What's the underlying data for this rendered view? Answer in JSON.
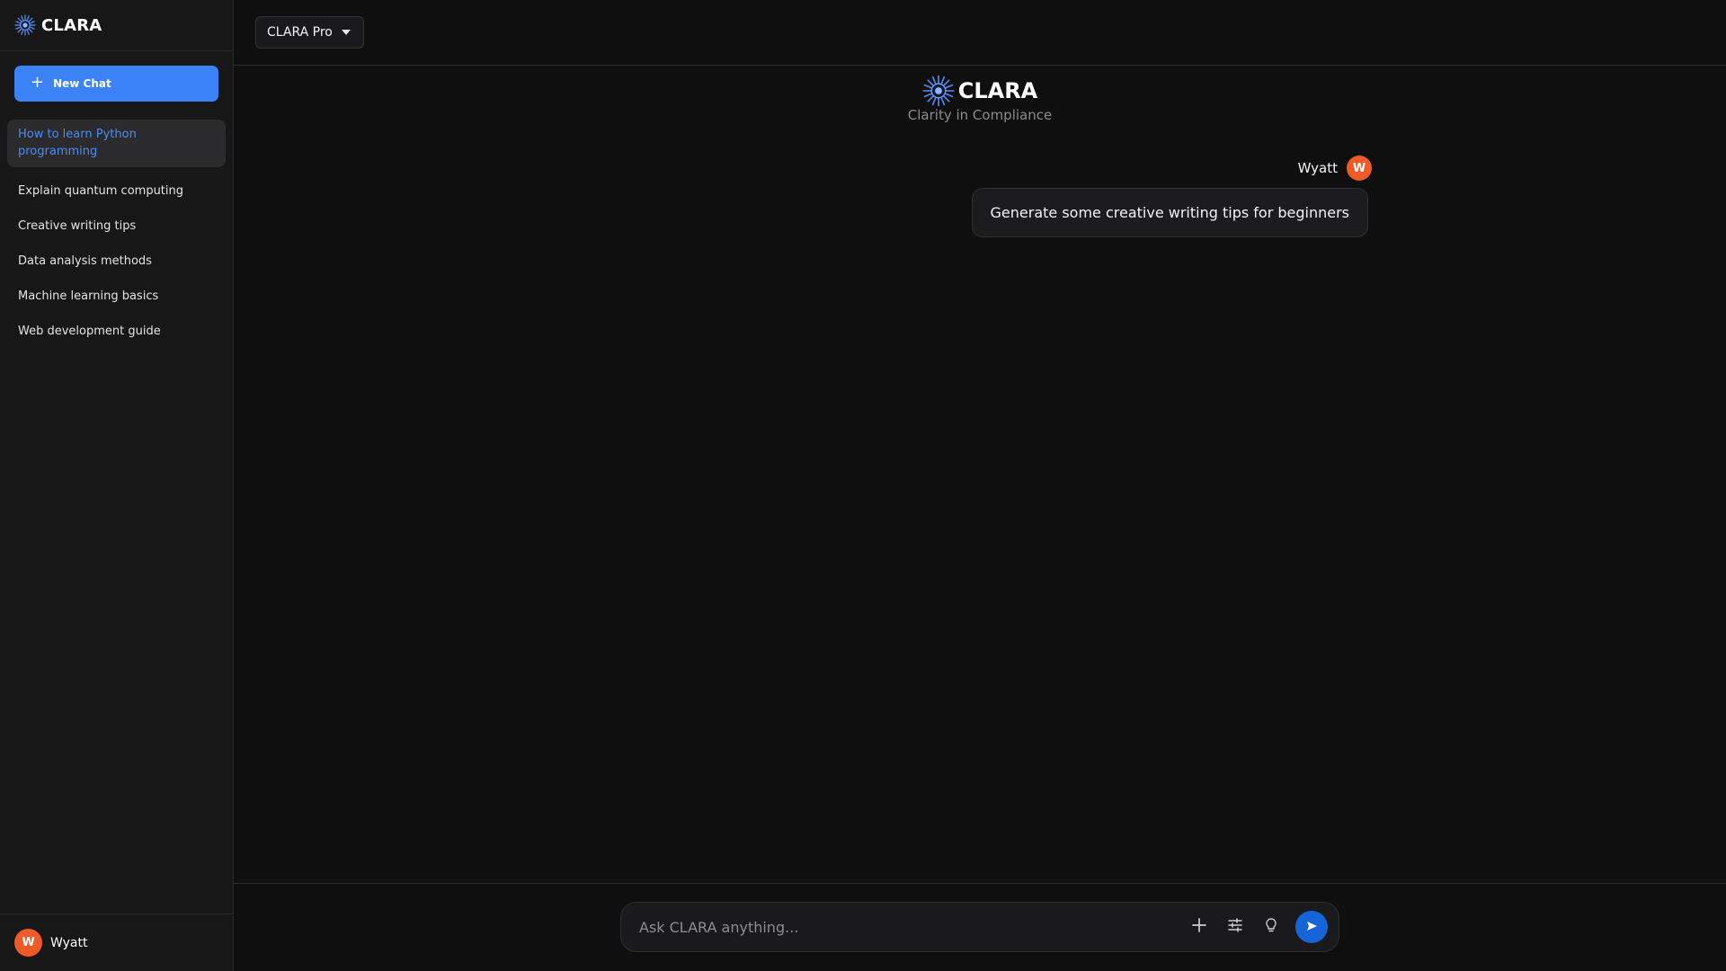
{
  "sidebar": {
    "brand": "CLARA",
    "new_chat_label": "New Chat",
    "history": [
      {
        "label": "How to learn Python programming",
        "active": true
      },
      {
        "label": "Explain quantum computing"
      },
      {
        "label": "Creative writing tips"
      },
      {
        "label": "Data analysis methods"
      },
      {
        "label": "Machine learning basics"
      },
      {
        "label": "Web development guide"
      }
    ],
    "user": {
      "initial": "W",
      "name": "Wyatt"
    }
  },
  "topbar": {
    "model_label": "CLARA Pro"
  },
  "hero": {
    "title": "CLARA",
    "tagline": "Clarity in Compliance"
  },
  "messages": [
    {
      "author": "Wyatt",
      "initial": "W",
      "text": "Generate some creative writing tips for beginners"
    }
  ],
  "composer": {
    "placeholder": "Ask CLARA anything..."
  },
  "icons": {
    "logo": "starburst-logo-icon",
    "attach": "plus-icon",
    "settings": "sliders-icon",
    "ideas": "lightbulb-icon",
    "send": "send-icon"
  },
  "colors": {
    "accent": "#3b82f6",
    "active_text": "#4a8cf5",
    "avatar": "#f05a28",
    "send": "#1565d8",
    "background": "#0f0f10",
    "sidebar": "#171718"
  }
}
